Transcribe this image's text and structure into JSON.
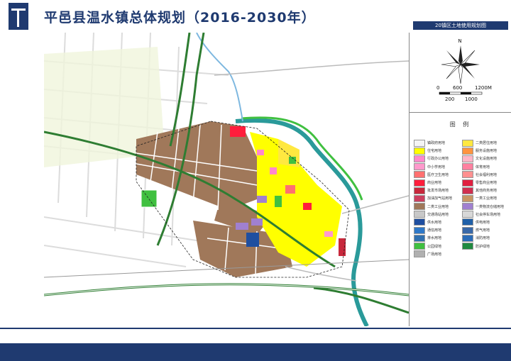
{
  "header": {
    "title": "平邑县温水镇总体规划（2016-2030年）",
    "subtitle": "20镇区土地使用规划图"
  },
  "compass": {
    "north_label": "N",
    "scale_top": [
      "0",
      "600",
      "1200M"
    ],
    "scale_bottom": [
      "200",
      "1000"
    ]
  },
  "legend": {
    "title": "图 例",
    "left": [
      {
        "label": "镇政府用地",
        "color": "#f4f4f4"
      },
      {
        "label": "住宅用地",
        "color": "#ffff00"
      },
      {
        "label": "行政办公用地",
        "color": "#ff88cc"
      },
      {
        "label": "中小学用地",
        "color": "#ff99cc"
      },
      {
        "label": "医疗卫生用地",
        "color": "#ff7070"
      },
      {
        "label": "商业用地",
        "color": "#ff1e3c"
      },
      {
        "label": "批发市场用地",
        "color": "#c8283c"
      },
      {
        "label": "加油加气站用地",
        "color": "#cc4060"
      },
      {
        "label": "二类工业用地",
        "color": "#a0785a"
      },
      {
        "label": "交通场站用地",
        "color": "#c8c8c8"
      },
      {
        "label": "供水用地",
        "color": "#1f4fa0"
      },
      {
        "label": "通信用地",
        "color": "#2e78c8"
      },
      {
        "label": "排水用地",
        "color": "#3070b0"
      },
      {
        "label": "公园绿地",
        "color": "#40c040"
      },
      {
        "label": "广场用地",
        "color": "#b0b0b0"
      }
    ],
    "right": [
      {
        "label": "二类居住用地",
        "color": "#ffe840"
      },
      {
        "label": "服务设施用地",
        "color": "#ff9440"
      },
      {
        "label": "文化设施用地",
        "color": "#ffb6c8"
      },
      {
        "label": "体育用地",
        "color": "#ff80a0"
      },
      {
        "label": "社会福利用地",
        "color": "#ff9090"
      },
      {
        "label": "零售商业用地",
        "color": "#e02040"
      },
      {
        "label": "其他商务用地",
        "color": "#d03050"
      },
      {
        "label": "一类工业用地",
        "color": "#c89664"
      },
      {
        "label": "一类物流仓储用地",
        "color": "#a080d0"
      },
      {
        "label": "社会停车场用地",
        "color": "#d8d8d8"
      },
      {
        "label": "供电用地",
        "color": "#2060a8"
      },
      {
        "label": "燃气用地",
        "color": "#3868a8"
      },
      {
        "label": "消防用地",
        "color": "#2a6cb8"
      },
      {
        "label": "防护绿地",
        "color": "#208a40"
      }
    ]
  },
  "colors": {
    "brand": "#1f3a70",
    "industrial": "#a0785a",
    "residential": "#ffff00",
    "river": "#2a9a9a",
    "road_green": "#2e7d32"
  }
}
